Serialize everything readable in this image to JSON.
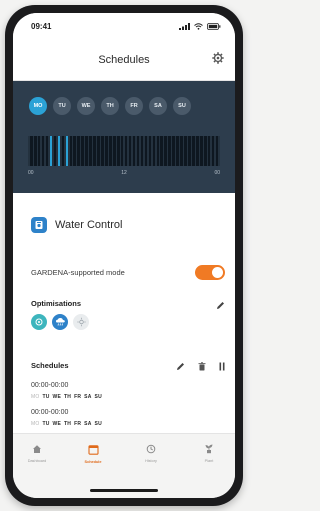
{
  "status_bar": {
    "time": "09:41"
  },
  "header": {
    "title": "Schedules"
  },
  "timeline": {
    "days": [
      {
        "label": "MO",
        "active": true
      },
      {
        "label": "TU",
        "active": false
      },
      {
        "label": "WE",
        "active": false
      },
      {
        "label": "TH",
        "active": false
      },
      {
        "label": "FR",
        "active": false
      },
      {
        "label": "SA",
        "active": false
      },
      {
        "label": "SU",
        "active": false
      }
    ],
    "axis_labels": [
      "00",
      "12",
      "00"
    ]
  },
  "water_control": {
    "title": "Water Control",
    "mode_label": "GARDENA-supported mode",
    "mode_enabled": true
  },
  "optimisations": {
    "title": "Optimisations",
    "icons": [
      "eco-icon",
      "rain-cloud-icon",
      "sun-icon"
    ]
  },
  "schedules": {
    "title": "Schedules",
    "items": [
      {
        "time": "00:00-00:00",
        "days": [
          {
            "label": "MO",
            "on": false
          },
          {
            "label": "TU",
            "on": true
          },
          {
            "label": "WE",
            "on": true
          },
          {
            "label": "TH",
            "on": true
          },
          {
            "label": "FR",
            "on": true
          },
          {
            "label": "SA",
            "on": true
          },
          {
            "label": "SU",
            "on": true
          }
        ]
      },
      {
        "time": "00:00-00:00",
        "days": [
          {
            "label": "MO",
            "on": false
          },
          {
            "label": "TU",
            "on": true
          },
          {
            "label": "WE",
            "on": true
          },
          {
            "label": "TH",
            "on": true
          },
          {
            "label": "FR",
            "on": true
          },
          {
            "label": "SA",
            "on": true
          },
          {
            "label": "SU",
            "on": true
          }
        ]
      }
    ]
  },
  "tabbar": {
    "tabs": [
      {
        "label": "Dashboard",
        "icon": "home-icon",
        "active": false
      },
      {
        "label": "Schedule",
        "icon": "calendar-icon",
        "active": true
      },
      {
        "label": "History",
        "icon": "history-icon",
        "active": false
      },
      {
        "label": "Plant",
        "icon": "plant-icon",
        "active": false
      }
    ]
  },
  "colors": {
    "accent": "#f07a24",
    "timeline_bg": "#2d3d4d",
    "active_day": "#2ba2d6",
    "device_blue": "#2e82c9"
  }
}
